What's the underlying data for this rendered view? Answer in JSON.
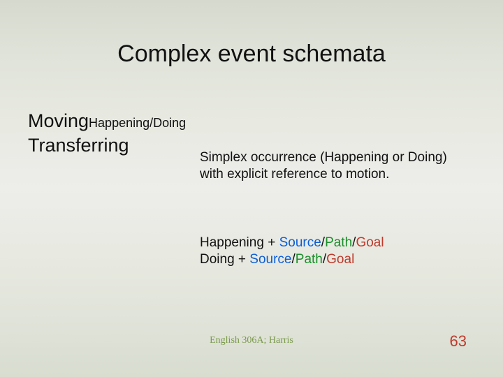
{
  "title": "Complex event schemata",
  "left": {
    "moving": "Moving",
    "moving_sub": "Happening/Doing",
    "transferring": "Transferring"
  },
  "body": {
    "definition": "Simplex occurrence (Happening or Doing) with explicit reference to motion."
  },
  "formula": {
    "line1_pre": "Happening + ",
    "line2_pre": "Doing + ",
    "source": "Source",
    "path": "Path",
    "goal": "Goal",
    "slash": "/"
  },
  "footer": "English 306A; Harris",
  "page": "63"
}
